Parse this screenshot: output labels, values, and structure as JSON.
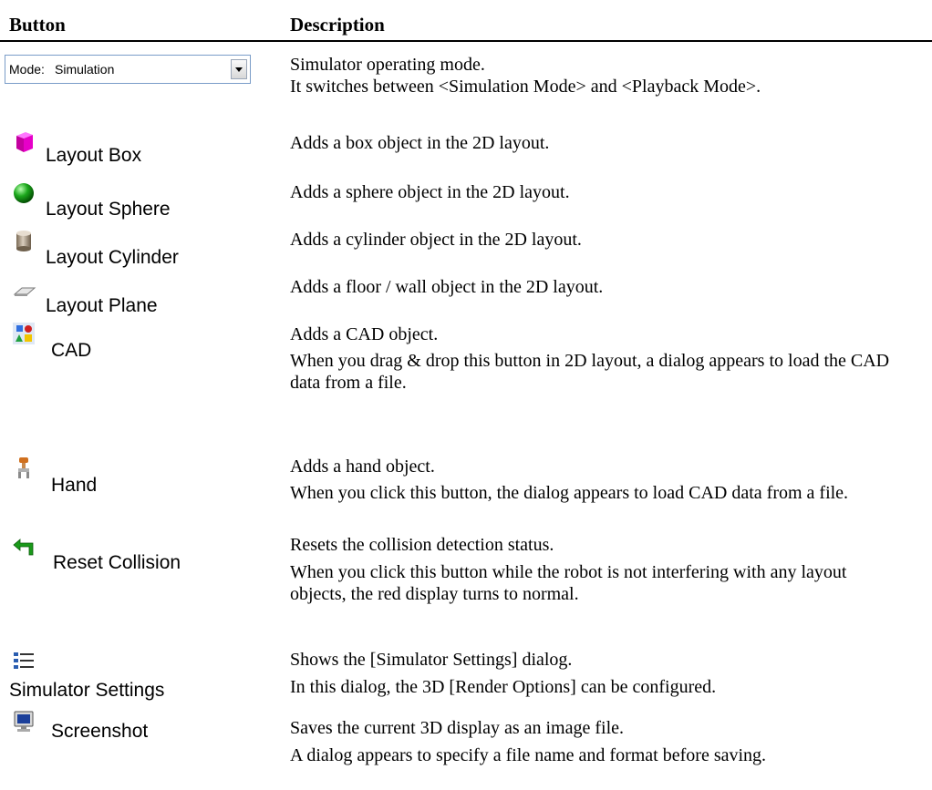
{
  "header": {
    "col_button": "Button",
    "col_description": "Description"
  },
  "mode_combo": {
    "label": "Mode:",
    "value": "Simulation"
  },
  "rows": [
    {
      "description": [
        "Simulator operating mode.",
        "It switches between <Simulation Mode> and <Playback Mode>."
      ]
    },
    {
      "label": "Layout Box",
      "icon": "box-icon",
      "description": [
        "Adds a box object in the 2D layout."
      ]
    },
    {
      "label": "Layout Sphere",
      "icon": "sphere-icon",
      "description": [
        "Adds a sphere object in the 2D layout."
      ]
    },
    {
      "label": "Layout Cylinder",
      "icon": "cylinder-icon",
      "description": [
        "Adds a cylinder object in the 2D layout."
      ]
    },
    {
      "label": "Layout Plane",
      "icon": "plane-icon",
      "description": [
        "Adds a floor / wall object in the 2D layout."
      ]
    },
    {
      "label": "CAD",
      "icon": "cad-icon",
      "description": [
        "Adds a CAD object.",
        "When you drag & drop this button in 2D layout, a dialog appears to load the CAD data from a file."
      ]
    },
    {
      "label": "Hand",
      "icon": "hand-icon",
      "description": [
        "Adds a hand object.",
        "When you click this button, the dialog appears to load CAD data from a file."
      ]
    },
    {
      "label": "Reset Collision",
      "icon": "reset-arrow-icon",
      "description": [
        "Resets the collision detection status.",
        "When you click this button while the robot is not interfering with any layout objects, the red display turns to normal."
      ]
    },
    {
      "label": "Simulator Settings",
      "icon": "settings-list-icon",
      "description": [
        "Shows the [Simulator Settings] dialog.",
        "In this dialog, the 3D [Render Options] can be configured."
      ]
    },
    {
      "label": "Screenshot",
      "icon": "monitor-icon",
      "description": [
        "Saves the current 3D display as an image file.",
        "A dialog appears to specify a file name and format before saving."
      ]
    }
  ]
}
